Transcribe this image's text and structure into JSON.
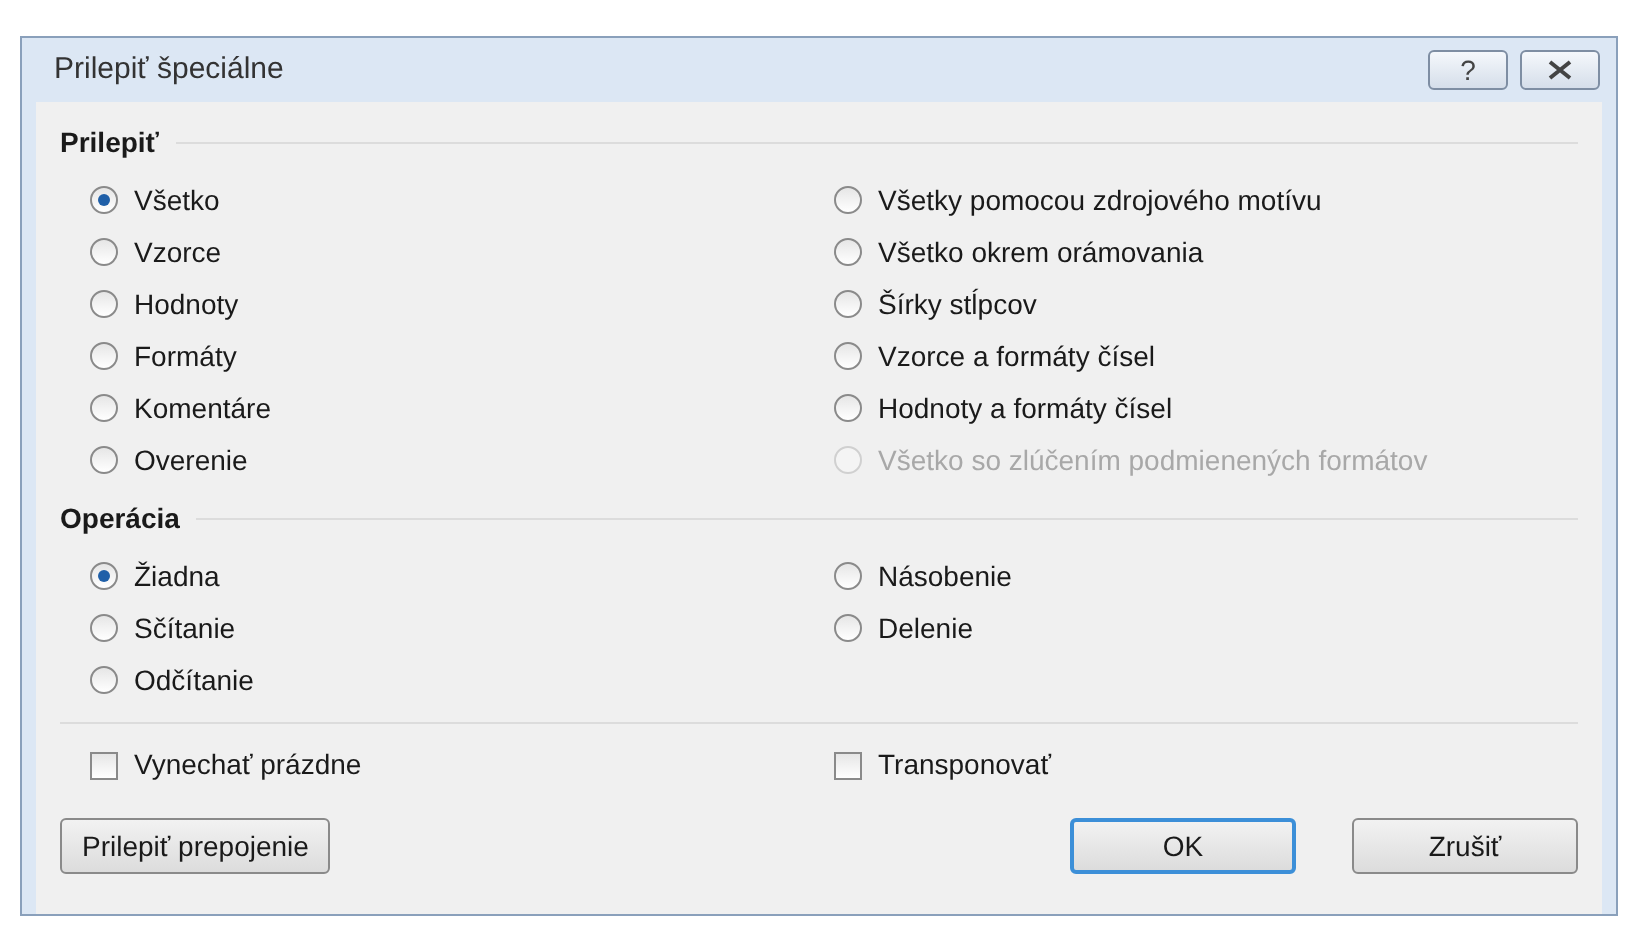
{
  "window": {
    "title": "Prilepiť špeciálne",
    "buttons": [
      {
        "kind": "help",
        "label": "?"
      },
      {
        "kind": "close"
      }
    ]
  },
  "paste": {
    "title": "Prilepiť",
    "options": [
      {
        "label": "Všetko",
        "selected": true,
        "disabled": false
      },
      {
        "label": "Vzorce",
        "selected": false,
        "disabled": false
      },
      {
        "label": "Hodnoty",
        "selected": false,
        "disabled": false
      },
      {
        "label": "Formáty",
        "selected": false,
        "disabled": false
      },
      {
        "label": "Komentáre",
        "selected": false,
        "disabled": false
      },
      {
        "label": "Overenie",
        "selected": false,
        "disabled": false
      },
      {
        "label": "Všetky pomocou zdrojového motívu",
        "selected": false,
        "disabled": false
      },
      {
        "label": "Všetko okrem orámovania",
        "selected": false,
        "disabled": false
      },
      {
        "label": "Šírky stĺpcov",
        "selected": false,
        "disabled": false
      },
      {
        "label": "Vzorce a formáty čísel",
        "selected": false,
        "disabled": false
      },
      {
        "label": "Hodnoty a formáty čísel",
        "selected": false,
        "disabled": false
      },
      {
        "label": "Všetko so zlúčením podmienených formátov",
        "selected": false,
        "disabled": true
      }
    ]
  },
  "operation": {
    "title": "Operácia",
    "options": [
      {
        "label": "Žiadna",
        "selected": true
      },
      {
        "label": "Sčítanie",
        "selected": false
      },
      {
        "label": "Odčítanie",
        "selected": false
      },
      {
        "label": "Násobenie",
        "selected": false
      },
      {
        "label": "Delenie",
        "selected": false
      }
    ]
  },
  "checkboxes": [
    {
      "label": "Vynechať prázdne",
      "checked": false
    },
    {
      "label": "Transponovať",
      "checked": false
    }
  ],
  "buttons": [
    {
      "label": "Prilepiť prepojenie",
      "kind": "link"
    },
    {
      "label": "OK",
      "kind": "default"
    },
    {
      "label": "Zrušiť",
      "kind": "normal"
    }
  ]
}
